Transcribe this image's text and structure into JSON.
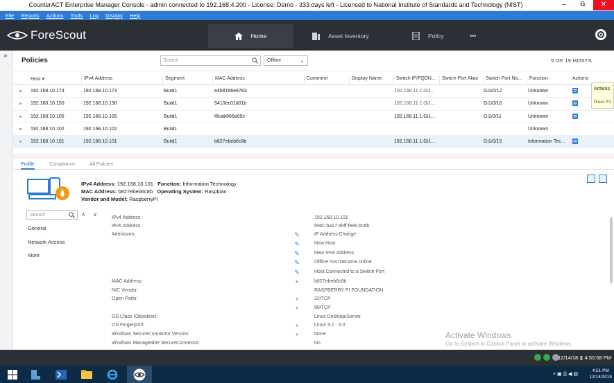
{
  "window": {
    "title": "CounterACT Enterprise Manager Console - admin connected to 192.168.4.200 - License: Demo - 333 days left - Licensed to National Institute of Standards and Technology (NIST)",
    "minimize": "–",
    "restore": "⧉",
    "close": "✕"
  },
  "menu": [
    "File",
    "Reports",
    "Actions",
    "Tools",
    "Log",
    "Display",
    "Help"
  ],
  "header": {
    "logo": "ForeScout",
    "tabs": [
      {
        "label": "Home",
        "icon": "home-icon"
      },
      {
        "label": "Asset Inventory",
        "icon": "asset-inventory-icon"
      },
      {
        "label": "Policy",
        "icon": "policy-icon"
      }
    ],
    "more": "•••"
  },
  "sidebar_toggle": "»",
  "policies": {
    "title": "Policies",
    "search_placeholder": "Search",
    "filter_value": "Offline",
    "count_text": "5 OF 19 HOSTS"
  },
  "table": {
    "columns": [
      "Host ▾",
      "IPv4 Address",
      "Segment",
      "MAC Address",
      "Comment",
      "Display Name",
      "Switch IP/FQDN...",
      "Switch Port Alias",
      "Switch Port Na...",
      "Function",
      "Actions"
    ],
    "rows": [
      {
        "host": "192.168.10.173",
        "ip": "192.168.10.173",
        "segment": "Build1",
        "mac": "e4b8186e8783",
        "switch_ip": "192.168.11.1:Gi1...",
        "port_name": "Gi1/0/12",
        "function": "Unknown"
      },
      {
        "host": "192.168.10.150",
        "ip": "192.168.10.150",
        "segment": "Build1",
        "mac": "5410ec01d01b",
        "switch_ip": "192.168.11.1:Gi1...",
        "port_name": "Gi1/0/16",
        "function": "Unknown"
      },
      {
        "host": "192.168.10.105",
        "ip": "192.168.10.105",
        "segment": "Build1",
        "mac": "f8cab866a09c",
        "switch_ip": "192.168.11.1:Gi1...",
        "port_name": "Gi1/0/11",
        "function": "Unknown"
      },
      {
        "host": "192.168.10.102",
        "ip": "192.168.10.102",
        "segment": "Build1",
        "mac": "",
        "switch_ip": "",
        "port_name": "",
        "function": "Unknown"
      },
      {
        "host": "192.168.10.101",
        "ip": "192.168.10.101",
        "segment": "Build1",
        "mac": "b827ebeb6c8b",
        "switch_ip": "192.168.11.1:Gi1...",
        "port_name": "Gi1/0/15",
        "function": "Information Tec..."
      }
    ]
  },
  "tooltip": {
    "line1": "Actions",
    "line2": "Press 'F2"
  },
  "detail": {
    "tabs": [
      "Profile",
      "Compliance",
      "All Policies"
    ],
    "summary": {
      "ipv4_label": "IPv4 Address:",
      "ipv4": "192.168.10.101",
      "function_label": "Function:",
      "function": "Information Technology",
      "mac_label": "MAC Address:",
      "mac": "b827ebeb6c8b",
      "os_label": "Operating System:",
      "os": "Raspbian",
      "vendor_label": "Vendor and Model:",
      "vendor": "RaspberryPi"
    },
    "search_placeholder": "Search",
    "up": "∧",
    "down": "∨",
    "nav": [
      "General",
      "Network Access",
      "More"
    ],
    "properties": [
      {
        "label": "IPv4 Address:",
        "values": [
          "192.168.10.101"
        ],
        "icon": ""
      },
      {
        "label": "IPv6 Address:",
        "values": [
          "fe80::ba27:ebff:feeb:6c8b"
        ],
        "icon": ""
      },
      {
        "label": "Admission:",
        "values": [
          "IP Address Change",
          "New Host",
          "New IPv6 Address",
          "Offline host became online",
          "Host Connected to a Switch Port"
        ],
        "icon": "pencil"
      },
      {
        "label": "MAC Address:",
        "values": [
          "b827ebeb6c8b"
        ],
        "icon": "plus"
      },
      {
        "label": "NIC Vendor:",
        "values": [
          "RASPBERRY PI FOUNDATION"
        ],
        "icon": ""
      },
      {
        "label": "Open Ports:",
        "values": [
          "22/TCP",
          "80/TCP"
        ],
        "icon": "plus"
      },
      {
        "label": "OS Class (Obsolete):",
        "values": [
          "Linux Desktop/Server"
        ],
        "icon": ""
      },
      {
        "label": "OS Fingerprint:",
        "values": [
          "Linux 3.2 - 4.0"
        ],
        "icon": "plus"
      },
      {
        "label": "Windows SecureConnector Version:",
        "values": [
          "None"
        ],
        "icon": "plus"
      },
      {
        "label": "Windows Manageable SecureConnector:",
        "values": [
          "No"
        ],
        "icon": ""
      }
    ]
  },
  "watermark": {
    "title": "Activate Windows",
    "subtitle": "Go to System in Control Panel to activate Windows."
  },
  "statusbar": {
    "time": "12/14/18 ⧗ 4:50:58 PM"
  },
  "taskbar": {
    "clock_time": "4:51 PM",
    "clock_date": "12/14/2018"
  }
}
